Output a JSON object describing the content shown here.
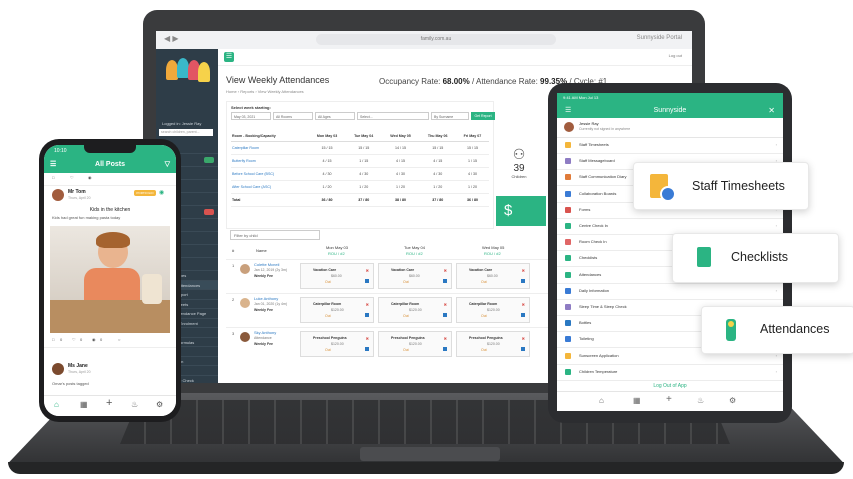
{
  "laptop": {
    "browser": {
      "url": "family.com.au",
      "right_text": "Sunnyside Portal"
    },
    "top_right": "Log out",
    "sidebar": {
      "logged_in": "Logged in: Jessie Ray",
      "search_placeholder": "search children, parent...",
      "items": [
        "Centre",
        "Sign",
        "",
        "",
        "",
        "",
        "",
        "",
        "",
        "",
        "Attendances",
        "Weekly Attendances",
        "Room Report",
        "Room Sheets",
        "Room Attendance Page",
        "Booking Enrolment",
        "Admin",
        "Patient Formulas",
        "Bookings",
        "Recreation",
        "Changes",
        "Timetable Check"
      ]
    },
    "page_title": "View Weekly Attendances",
    "breadcrumb": "Home  ›  Reports  ›  View Weekly Attendances",
    "rates": {
      "occupancy_label": "Occupancy Rate:",
      "occupancy": "68.00%",
      "attendance_label": "/ Attendance Rate:",
      "attendance": "99.35%",
      "cycle": "/ Cycle: #1"
    },
    "week_card": {
      "label": "Select week starting:",
      "filters": [
        "May 03, 2021",
        "All Rooms",
        "All Ages",
        "Select...",
        "By Surname"
      ],
      "report_button": "Get Report",
      "columns": [
        "Room - Booking/Capacity",
        "Mon May 03",
        "Tue May 04",
        "Wed May 05",
        "Thu May 06",
        "Fri May 07"
      ],
      "rows": [
        [
          "Caterpillar Room",
          "15 / 15",
          "15 / 15",
          "14 / 15",
          "15 / 15",
          "15 / 15"
        ],
        [
          "Butterfly Room",
          "4 / 15",
          "1 / 15",
          "4 / 15",
          "4 / 15",
          "1 / 15"
        ],
        [
          "Before School Care (BSC)",
          "4 / 30",
          "4 / 30",
          "4 / 30",
          "4 / 30",
          "4 / 30"
        ],
        [
          "After School Care (ASC)",
          "1 / 20",
          "1 / 20",
          "1 / 20",
          "1 / 20",
          "1 / 20"
        ],
        [
          "Total",
          "36 / 80",
          "37 / 80",
          "38 / 80",
          "37 / 80",
          "36 / 80"
        ]
      ]
    },
    "children": {
      "count": "39",
      "label": "Children"
    },
    "dollar": "$",
    "filter_child_placeholder": "Filter by child",
    "attendance": {
      "header": [
        "#",
        "Name",
        "Mon May 03",
        "Tue May 04",
        "Wed May 05"
      ],
      "header_sub": [
        "ROU / #2",
        "ROU / #2",
        "ROU / #2"
      ],
      "rows": [
        {
          "num": "1",
          "name": "Colette Mcneil",
          "sub1": "Jan 12, 2019 (2y 3m)",
          "sub2": "Weekly Fee",
          "slots": [
            [
              "Vacation Care",
              "$60.00",
              "Out"
            ],
            [
              "Vacation Care",
              "$60.00",
              "Out"
            ],
            [
              "Vacation Care",
              "$60.00",
              "Out"
            ]
          ]
        },
        {
          "num": "2",
          "name": "Luke Anthony",
          "sub1": "Jan 01, 2020 (1y 4m)",
          "sub2": "Weekly Fee",
          "slots": [
            [
              "Caterpillar Room",
              "$120.00",
              "Out"
            ],
            [
              "Caterpillar Room",
              "$120.00",
              "Out"
            ],
            [
              "Caterpillar Room",
              "$120.00",
              "Out"
            ]
          ]
        },
        {
          "num": "3",
          "name": "Sky Anthony",
          "sub1": "Attendance",
          "sub2": "Weekly Fee",
          "slots": [
            [
              "Preschool Penguins",
              "$120.00",
              "Out"
            ],
            [
              "Preschool Penguins",
              "$120.00",
              "Out"
            ],
            [
              "Preschool Penguins",
              "$120.00",
              "Out"
            ]
          ]
        }
      ]
    }
  },
  "tablet": {
    "status_time": "9:41 AM Mon Jul 13",
    "title": "Sunnyside",
    "user": {
      "name": "Jessie Ray",
      "sub": "Currently not signed in anywhere"
    },
    "items": [
      "Staff Timesheets",
      "Staff Messageboard",
      "Staff Communication Diary",
      "Collaboration Boards",
      "Forms",
      "Centre Check In",
      "Room Check In",
      "Checklists",
      "Attendances",
      "Daily Information",
      "Sleep Time & Sleep Check",
      "Bottles",
      "Toileting",
      "Sunscreen Application",
      "Children Temperature"
    ],
    "logout": "Log Out of App"
  },
  "callouts": [
    "Staff Timesheets",
    "Checklists",
    "Attendances"
  ],
  "phone": {
    "time": "10:10",
    "title": "All Posts",
    "post1": {
      "name": "Mr Tom",
      "date": "Thurs, April 20",
      "badge": "PORTFOLIO",
      "heading": "Kids in the kitchen",
      "text": "Kids had great fun making pasta today"
    },
    "post1_counts": [
      "0",
      "0",
      "0"
    ],
    "post2": {
      "name": "Ms Jane",
      "date": "Thurs, April 20",
      "text": "Omar's posts tagged"
    }
  },
  "colors": {
    "brand_green": "#2bb483",
    "sidebar": "#2e3d48"
  }
}
